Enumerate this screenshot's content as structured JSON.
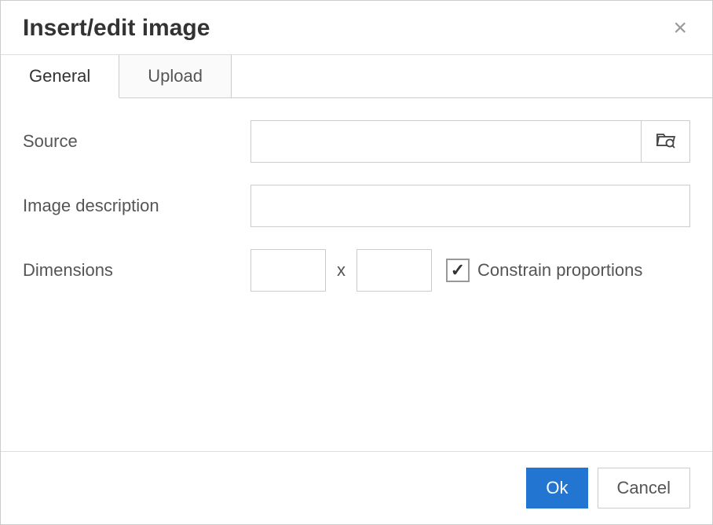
{
  "dialog": {
    "title": "Insert/edit image"
  },
  "tabs": {
    "general": "General",
    "upload": "Upload"
  },
  "form": {
    "source": {
      "label": "Source",
      "value": ""
    },
    "description": {
      "label": "Image description",
      "value": ""
    },
    "dimensions": {
      "label": "Dimensions",
      "width": "",
      "height": "",
      "separator": "x",
      "constrain_checked": true,
      "constrain_label": "Constrain proportions"
    }
  },
  "footer": {
    "ok": "Ok",
    "cancel": "Cancel"
  }
}
